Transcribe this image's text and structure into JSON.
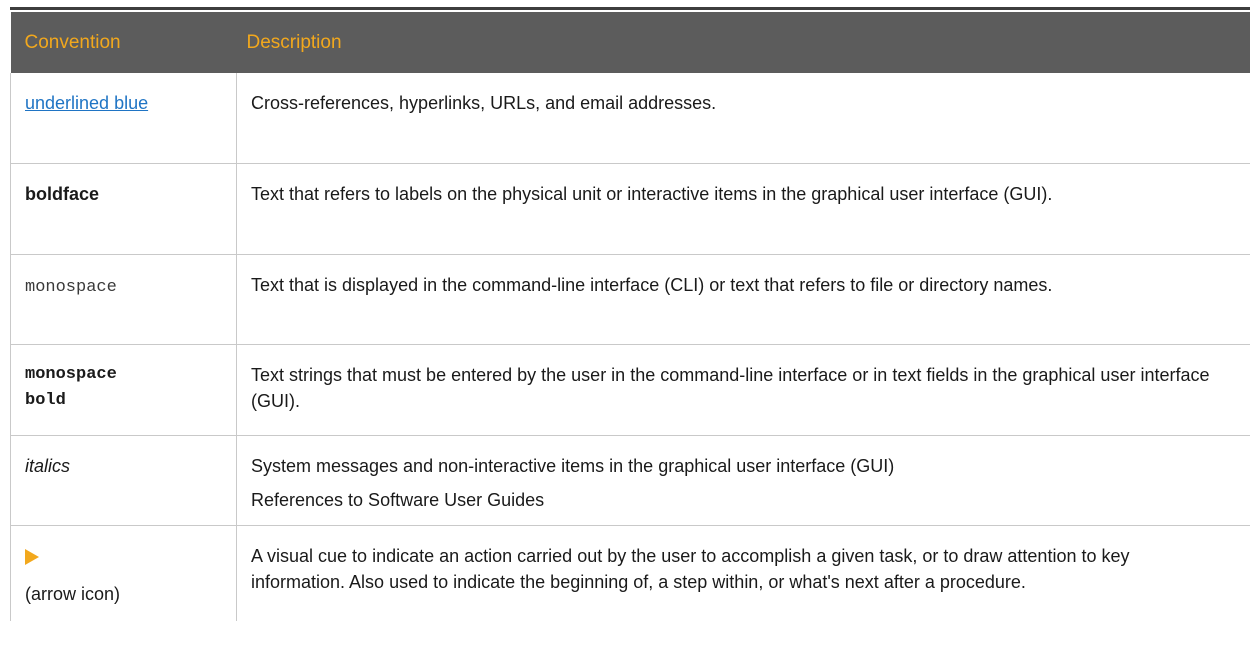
{
  "table": {
    "headers": {
      "convention": "Convention",
      "description": "Description"
    },
    "rows": [
      {
        "convention": "underlined blue",
        "description": "Cross-references, hyperlinks, URLs, and email addresses."
      },
      {
        "convention": "boldface",
        "description": "Text that refers to labels on the physical unit or interactive items in the graphical user interface (GUI)."
      },
      {
        "convention": "monospace",
        "description": "Text that is displayed in the command-line interface (CLI) or text that refers to file or directory names."
      },
      {
        "convention": "monospace bold",
        "description": "Text strings that must be entered by the user in the command-line interface or in text fields in the graphical user interface (GUI)."
      },
      {
        "convention": "italics",
        "description": "System messages and non-interactive items in the graphical user interface (GUI)",
        "description_2": "References to Software User Guides"
      },
      {
        "convention_icon": "arrow-icon",
        "convention": "(arrow icon)",
        "description": "A visual cue to indicate an action carried out by the user to accomplish a given task, or to draw attention to key information. Also used to indicate the beginning of, a step within, or what's next after a procedure."
      }
    ]
  },
  "colors": {
    "header_bg": "#5c5c5c",
    "header_text": "#f2a81d",
    "link": "#1f74c4",
    "arrow": "#f2a81d"
  }
}
